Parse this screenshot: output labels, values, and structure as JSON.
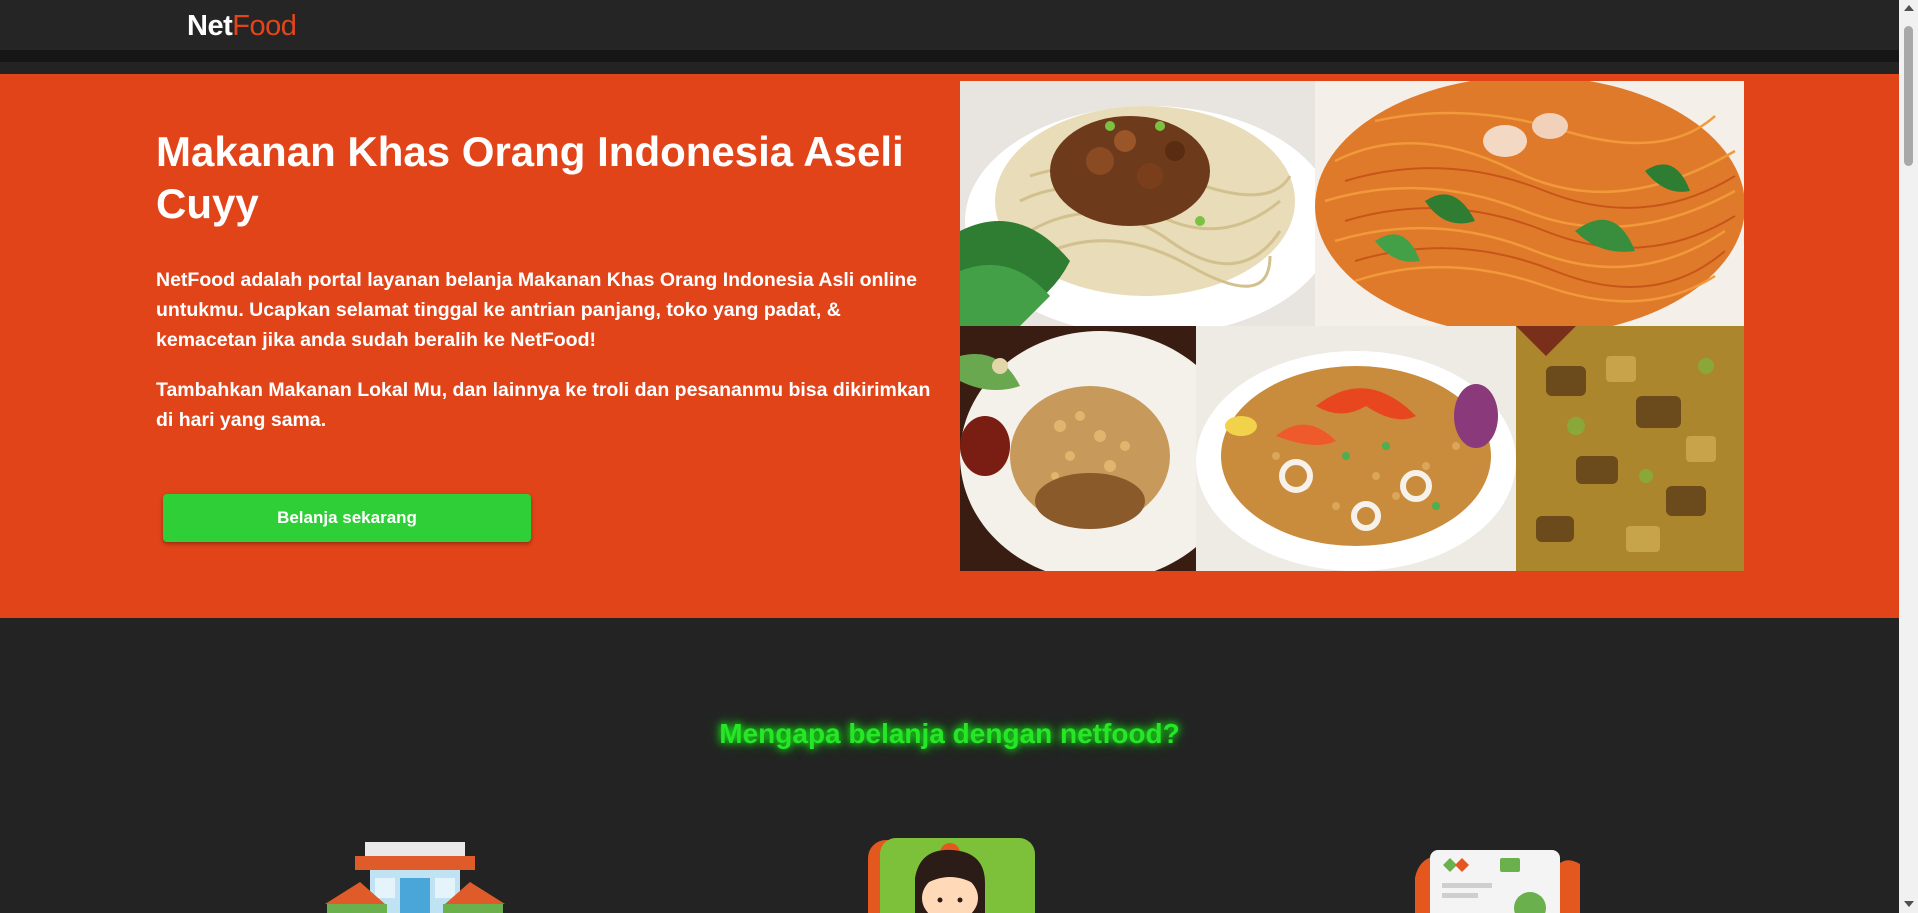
{
  "navbar": {
    "brand_part1": "Net",
    "brand_part2": "Food"
  },
  "hero": {
    "title": "Makanan Khas Orang Indonesia Aseli Cuyy",
    "paragraph1": "NetFood adalah portal layanan belanja Makanan Khas Orang Indonesia Asli online untukmu. Ucapkan selamat tinggal ke antrian panjang, toko yang padat, & kemacetan jika anda sudah beralih ke NetFood!",
    "paragraph2": "Tambahkan Makanan Lokal Mu, dan lainnya ke troli dan pesananmu bisa dikirimkan di hari yang sama.",
    "cta_label": "Belanja sekarang"
  },
  "gallery": {
    "images": [
      "noodle-bowl-image",
      "fried-vermicelli-image",
      "fried-chicken-image",
      "seafood-fried-rice-image",
      "curry-image"
    ]
  },
  "why": {
    "title": "Mengapa belanja dengan netfood?"
  },
  "features": {
    "icons": [
      "store-icon",
      "courier-girl-icon",
      "payment-card-icon"
    ]
  },
  "colors": {
    "brand_orange": "#e2441a",
    "cta_green": "#2fcf38",
    "neon_green": "#27e627",
    "dark_bg": "#232323"
  }
}
